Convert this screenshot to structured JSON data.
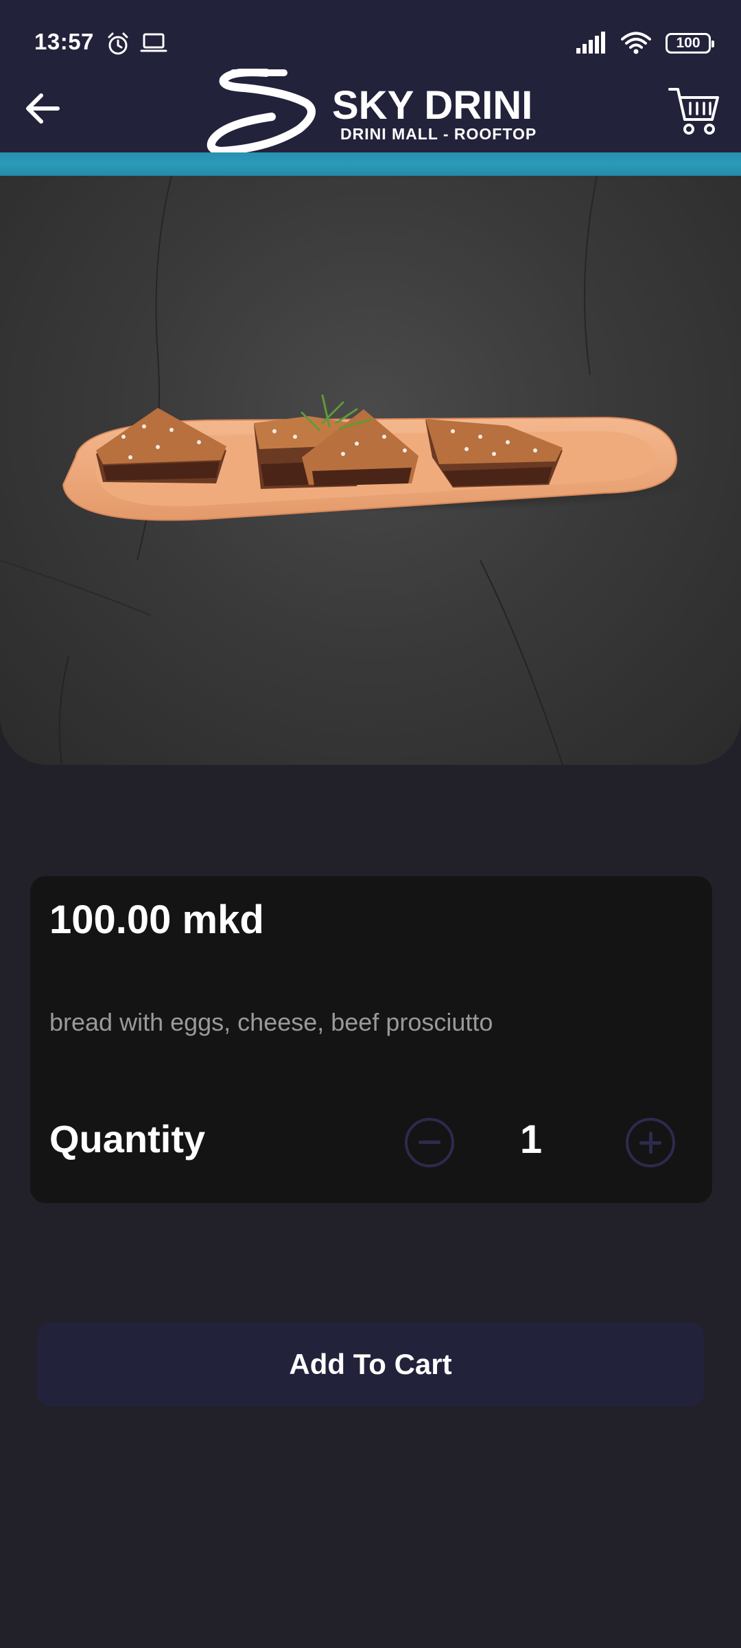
{
  "status_bar": {
    "time": "13:57",
    "battery": "100",
    "icons": [
      "alarm-icon",
      "laptop-icon",
      "signal-icon",
      "wifi-icon",
      "battery-icon"
    ]
  },
  "app_bar": {
    "brand": "SKY DRINI",
    "brand_sub": "DRINI MALL - ROOFTOP",
    "back_icon": "arrow-left-icon",
    "cart_icon": "cart-icon"
  },
  "product": {
    "price": "100.00 mkd",
    "description": "bread with eggs, cheese, beef prosciutto",
    "quantity_label": "Quantity",
    "quantity": "1"
  },
  "actions": {
    "add_to_cart": "Add To Cart"
  },
  "colors": {
    "app_bar": "#23223b",
    "accent_stripe": "#2a9ab8",
    "page_background": "#222129",
    "card_background": "#141414",
    "stepper_outline": "#2c2b4e",
    "description_text": "#9a9a9a"
  }
}
